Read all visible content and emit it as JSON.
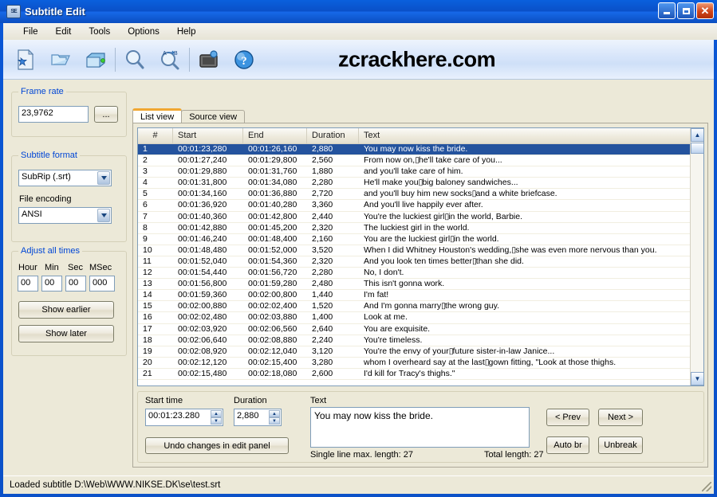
{
  "window": {
    "title": "Subtitle Edit",
    "icon": "app-icon",
    "buttons": {
      "minimize": "_",
      "maximize": "□",
      "close": "✕"
    }
  },
  "menubar": [
    {
      "label": "File"
    },
    {
      "label": "Edit"
    },
    {
      "label": "Tools"
    },
    {
      "label": "Options"
    },
    {
      "label": "Help"
    }
  ],
  "toolbar": {
    "watermark": "zcrackhere.com",
    "buttons": [
      {
        "icon": "new-file-icon"
      },
      {
        "icon": "open-folder-icon"
      },
      {
        "icon": "save-disk-icon"
      },
      {
        "icon": "find-magnifier-icon"
      },
      {
        "icon": "replace-magnifier-icon"
      },
      {
        "icon": "video-preview-icon"
      },
      {
        "icon": "help-question-icon"
      }
    ]
  },
  "sidebar": {
    "frame_rate": {
      "legend": "Frame rate",
      "value": "23,9762",
      "browse_label": "..."
    },
    "subtitle_format": {
      "legend": "Subtitle format",
      "value": "SubRip (.srt)"
    },
    "file_encoding": {
      "label": "File encoding",
      "value": "ANSI"
    },
    "adjust_all_times": {
      "legend": "Adjust all times",
      "fields": [
        {
          "label": "Hour",
          "value": "00"
        },
        {
          "label": "Min",
          "value": "00"
        },
        {
          "label": "Sec",
          "value": "00"
        },
        {
          "label": "MSec",
          "value": "000"
        }
      ],
      "show_earlier": "Show earlier",
      "show_later": "Show later"
    }
  },
  "tabs": [
    {
      "label": "List view",
      "active": true
    },
    {
      "label": "Source view",
      "active": false
    }
  ],
  "listview": {
    "columns": [
      "#",
      "Start",
      "End",
      "Duration",
      "Text"
    ],
    "rows": [
      {
        "n": "1",
        "start": "00:01:23,280",
        "end": "00:01:26,160",
        "dur": "2,880",
        "text": "You may now kiss the bride.",
        "selected": true
      },
      {
        "n": "2",
        "start": "00:01:27,240",
        "end": "00:01:29,800",
        "dur": "2,560",
        "text": "From now on,▯he'll take care of you..."
      },
      {
        "n": "3",
        "start": "00:01:29,880",
        "end": "00:01:31,760",
        "dur": "1,880",
        "text": "and you'll take care of him."
      },
      {
        "n": "4",
        "start": "00:01:31,800",
        "end": "00:01:34,080",
        "dur": "2,280",
        "text": "He'll make you▯big baloney sandwiches..."
      },
      {
        "n": "5",
        "start": "00:01:34,160",
        "end": "00:01:36,880",
        "dur": "2,720",
        "text": "and you'll buy him new socks▯and a white briefcase."
      },
      {
        "n": "6",
        "start": "00:01:36,920",
        "end": "00:01:40,280",
        "dur": "3,360",
        "text": "And you'll live happily ever after."
      },
      {
        "n": "7",
        "start": "00:01:40,360",
        "end": "00:01:42,800",
        "dur": "2,440",
        "text": "You're the luckiest girl▯in the world, Barbie."
      },
      {
        "n": "8",
        "start": "00:01:42,880",
        "end": "00:01:45,200",
        "dur": "2,320",
        "text": "The luckiest girl in the world."
      },
      {
        "n": "9",
        "start": "00:01:46,240",
        "end": "00:01:48,400",
        "dur": "2,160",
        "text": "You are the luckiest girl▯in the world."
      },
      {
        "n": "10",
        "start": "00:01:48,480",
        "end": "00:01:52,000",
        "dur": "3,520",
        "text": "When I did Whitney Houston's wedding,▯she was even more nervous than you."
      },
      {
        "n": "11",
        "start": "00:01:52,040",
        "end": "00:01:54,360",
        "dur": "2,320",
        "text": "And you look ten times better▯than she did."
      },
      {
        "n": "12",
        "start": "00:01:54,440",
        "end": "00:01:56,720",
        "dur": "2,280",
        "text": "No, I don't."
      },
      {
        "n": "13",
        "start": "00:01:56,800",
        "end": "00:01:59,280",
        "dur": "2,480",
        "text": "This isn't gonna work."
      },
      {
        "n": "14",
        "start": "00:01:59,360",
        "end": "00:02:00,800",
        "dur": "1,440",
        "text": "I'm fat!"
      },
      {
        "n": "15",
        "start": "00:02:00,880",
        "end": "00:02:02,400",
        "dur": "1,520",
        "text": "And I'm gonna marry▯the wrong guy."
      },
      {
        "n": "16",
        "start": "00:02:02,480",
        "end": "00:02:03,880",
        "dur": "1,400",
        "text": "Look at me."
      },
      {
        "n": "17",
        "start": "00:02:03,920",
        "end": "00:02:06,560",
        "dur": "2,640",
        "text": "You are exquisite."
      },
      {
        "n": "18",
        "start": "00:02:06,640",
        "end": "00:02:08,880",
        "dur": "2,240",
        "text": "You're timeless."
      },
      {
        "n": "19",
        "start": "00:02:08,920",
        "end": "00:02:12,040",
        "dur": "3,120",
        "text": "You're the envy of your▯future sister-in-law Janice..."
      },
      {
        "n": "20",
        "start": "00:02:12,120",
        "end": "00:02:15,400",
        "dur": "3,280",
        "text": "whom I overheard say at the last▯gown fitting, \"Look at those thighs."
      },
      {
        "n": "21",
        "start": "00:02:15,480",
        "end": "00:02:18,080",
        "dur": "2,600",
        "text": "I'd kill for Tracy's thighs.\""
      }
    ]
  },
  "editpanel": {
    "start_time_label": "Start time",
    "start_time_value": "00:01:23.280",
    "duration_label": "Duration",
    "duration_value": "2,880",
    "text_label": "Text",
    "text_value": "You may now kiss the bride.",
    "undo_label": "Undo changes in edit panel",
    "single_line_info": "Single line max. length: 27",
    "total_length_info": "Total length: 27",
    "prev_label": "< Prev",
    "next_label": "Next >",
    "autobr_label": "Auto br",
    "unbreak_label": "Unbreak"
  },
  "statusbar": {
    "text": "Loaded subtitle D:\\Web\\WWW.NIKSE.DK\\se\\test.srt"
  },
  "colors": {
    "titlebar_blue": "#0a57d6",
    "window_bg": "#ece9d8",
    "selection_blue": "#24539e",
    "legend_blue": "#0046d5",
    "active_tab_accent": "#f0a732"
  }
}
